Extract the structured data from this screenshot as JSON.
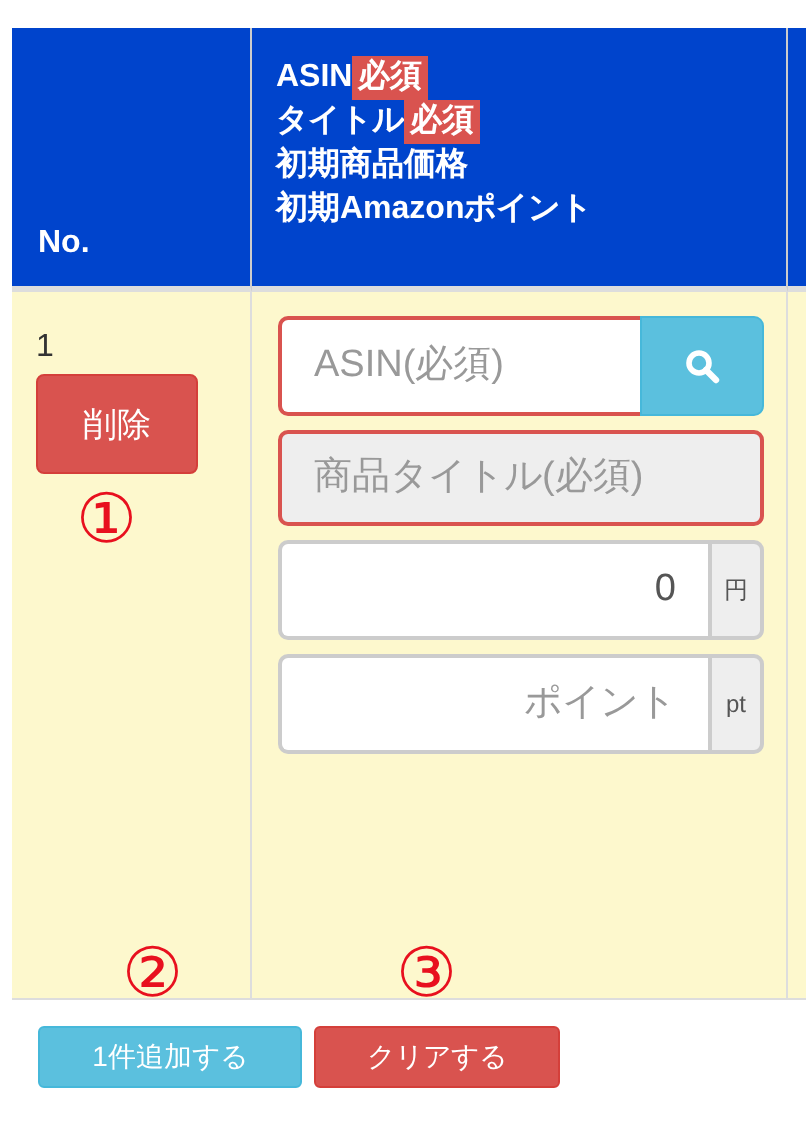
{
  "header": {
    "no_label": "No.",
    "lines": [
      {
        "text": "ASIN",
        "badge": "必須"
      },
      {
        "text": "タイトル",
        "badge": "必須"
      },
      {
        "text": "初期商品価格"
      },
      {
        "text": "初期Amazonポイント"
      }
    ]
  },
  "row": {
    "number": "1",
    "delete_button": "削除",
    "asin": {
      "placeholder": "ASIN(必須)"
    },
    "title": {
      "placeholder": "商品タイトル(必須)",
      "disabled": true
    },
    "price": {
      "value": "0",
      "unit": "円"
    },
    "points": {
      "placeholder": "ポイント",
      "unit": "pt"
    }
  },
  "footer_buttons": [
    {
      "label": "1件追加する",
      "kind": "info"
    },
    {
      "label": "クリアする",
      "kind": "danger"
    }
  ],
  "annotations": [
    "①",
    "②",
    "③"
  ]
}
